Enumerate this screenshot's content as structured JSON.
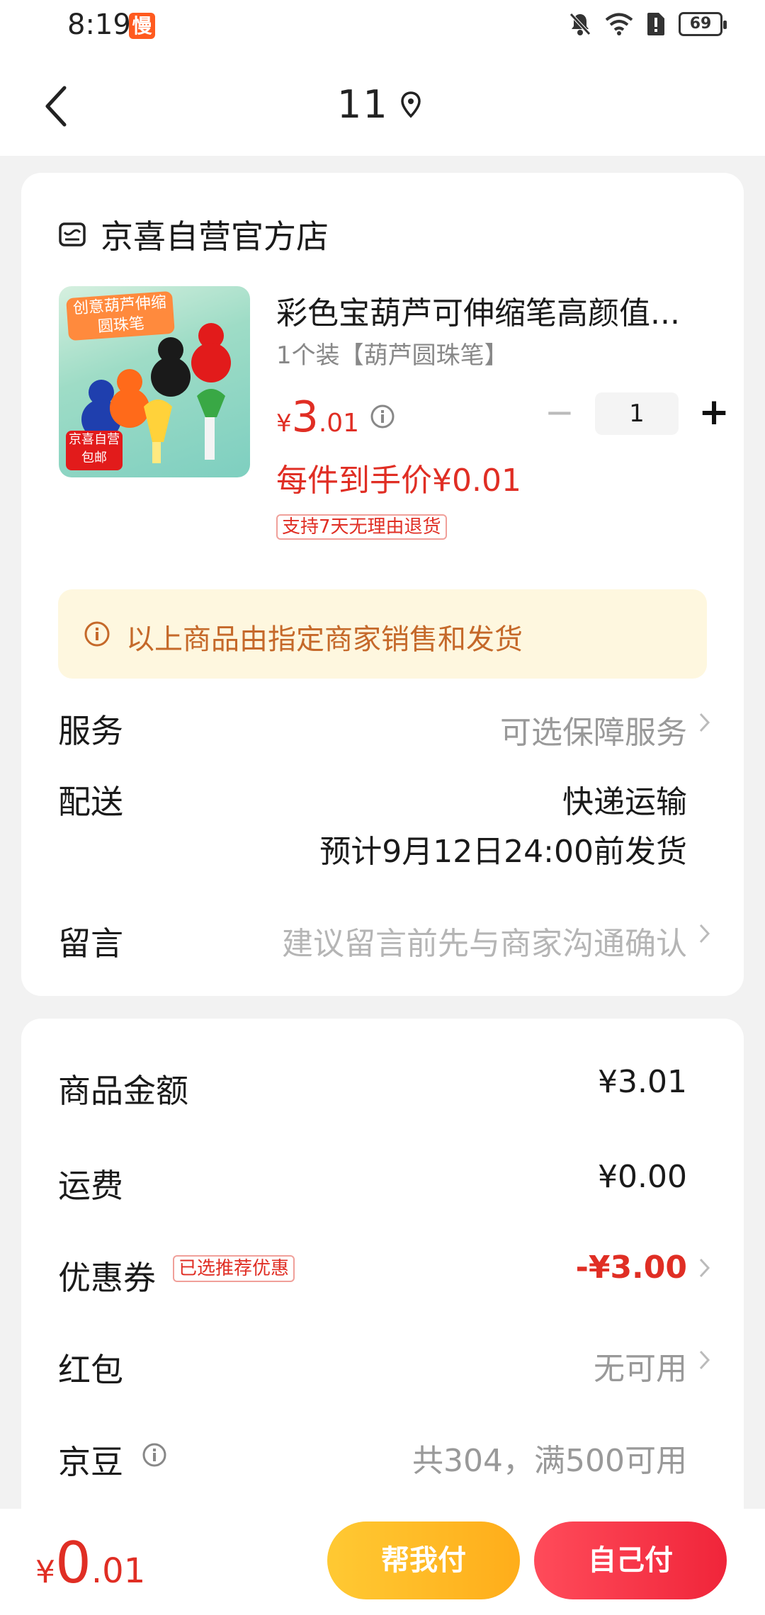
{
  "status_bar": {
    "time": "8:19",
    "app_badge": "慢",
    "battery": "69"
  },
  "header": {
    "title": "11"
  },
  "shop": {
    "name": "京喜自营官方店"
  },
  "product": {
    "image_banner": "创意葫芦伸缩圆珠笔",
    "image_tag": "京喜自营 包邮",
    "title": "彩色宝葫芦可伸缩笔高颜值...",
    "spec": "1个装【葫芦圆珠笔】",
    "price_currency": "¥",
    "price_int": "3",
    "price_dec": ".01",
    "quantity": "1",
    "final_price": "每件到手价¥0.01",
    "return_policy": "支持7天无理由退货"
  },
  "notice": {
    "text": "以上商品由指定商家销售和发货"
  },
  "rows": {
    "service_label": "服务",
    "service_value": "可选保障服务",
    "delivery_label": "配送",
    "delivery_method": "快递运输",
    "delivery_eta": "预计9月12日24:00前发货",
    "message_label": "留言",
    "message_placeholder": "建议留言前先与商家沟通确认"
  },
  "summary": {
    "goods_label": "商品金额",
    "goods_value": "¥3.01",
    "shipping_label": "运费",
    "shipping_value": "¥0.00",
    "coupon_label": "优惠券",
    "coupon_badge": "已选推荐优惠",
    "coupon_value": "-¥3.00",
    "redpacket_label": "红包",
    "redpacket_value": "无可用",
    "jingdou_label": "京豆",
    "jingdou_value": "共304，满500可用"
  },
  "bottom": {
    "total_currency": "¥",
    "total_int": "0",
    "total_dec": ".01",
    "help_pay": "帮我付",
    "self_pay": "自己付"
  },
  "colors": {
    "accent_red": "#e02e24",
    "notice_bg": "#fef7df",
    "help_btn": "#ffbb22",
    "self_btn": "#f5304a"
  }
}
